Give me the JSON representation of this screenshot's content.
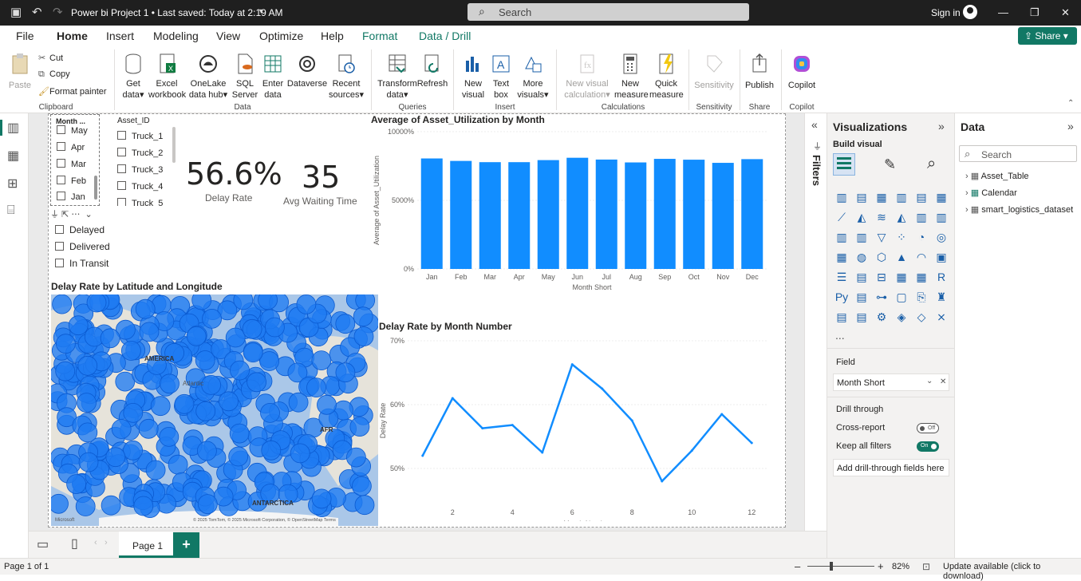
{
  "titlebar": {
    "file_title": "Power bi Project 1  •  Last saved: Today at 2:19 AM",
    "search_placeholder": "Search",
    "sign_in": "Sign in"
  },
  "menu": {
    "tabs": [
      "File",
      "Home",
      "Insert",
      "Modeling",
      "View",
      "Optimize",
      "Help",
      "Format",
      "Data / Drill"
    ],
    "active": "Home",
    "share": "Share"
  },
  "ribbon": {
    "clipboard": {
      "paste": "Paste",
      "cut": "Cut",
      "copy": "Copy",
      "format_painter": "Format painter",
      "label": "Clipboard"
    },
    "data": {
      "get_data": "Get data",
      "excel": "Excel workbook",
      "onelake": "OneLake data hub",
      "sql": "SQL Server",
      "enter": "Enter data",
      "dataverse": "Dataverse",
      "recent": "Recent sources",
      "label": "Data"
    },
    "queries": {
      "transform": "Transform data",
      "refresh": "Refresh",
      "label": "Queries"
    },
    "insert": {
      "new_visual": "New visual",
      "text_box": "Text box",
      "more_visuals": "More visuals",
      "label": "Insert"
    },
    "calculations": {
      "new_visual_calc": "New visual calculation",
      "new_measure": "New measure",
      "quick_measure": "Quick measure",
      "label": "Calculations"
    },
    "sensitivity": {
      "btn": "Sensitivity",
      "label": "Sensitivity"
    },
    "share": {
      "publish": "Publish",
      "label": "Share"
    },
    "copilot": {
      "btn": "Copilot",
      "label": "Copilot"
    }
  },
  "slicers": {
    "month": {
      "header": "Month ...",
      "items": [
        "May",
        "Apr",
        "Mar",
        "Feb",
        "Jan"
      ]
    },
    "asset": {
      "header": "Asset_ID",
      "items": [
        "Truck_1",
        "Truck_2",
        "Truck_3",
        "Truck_4",
        "Truck_5"
      ]
    },
    "status": {
      "items": [
        "Delayed",
        "Delivered",
        "In Transit"
      ]
    }
  },
  "kpis": {
    "delay_rate": {
      "value": "56.6%",
      "label": "Delay Rate"
    },
    "avg_wait": {
      "value": "35",
      "label": "Avg Waiting Time"
    }
  },
  "map": {
    "title": "Delay Rate by Latitude and Longitude",
    "label_america": "AMERICA",
    "label_antarctica": "ANTARCTICA",
    "label_atlantic": "Atlantic",
    "label_afr": "AFR",
    "credits": "© 2025 TomTom, © 2025 Microsoft Corporation, © OpenStreetMap Terms",
    "brand": "Microsoft"
  },
  "chart_data": [
    {
      "type": "bar",
      "title": "Average of Asset_Utilization by Month",
      "xlabel": "Month Short",
      "ylabel": "Average of Asset_Utilization",
      "categories": [
        "Jan",
        "Feb",
        "Mar",
        "Apr",
        "May",
        "Jun",
        "Jul",
        "Aug",
        "Sep",
        "Oct",
        "Nov",
        "Dec"
      ],
      "values": [
        8050,
        7870,
        7780,
        7780,
        7930,
        8100,
        7970,
        7760,
        8020,
        7960,
        7730,
        8000
      ],
      "yticks": [
        "0%",
        "5000%",
        "10000%"
      ],
      "ylim": [
        0,
        10000
      ],
      "color": "#118dff"
    },
    {
      "type": "line",
      "title": "Delay Rate by Month Number",
      "xlabel": "Month Number",
      "ylabel": "Delay Rate",
      "x": [
        1,
        2,
        3,
        4,
        5,
        6,
        7,
        8,
        9,
        10,
        11,
        12
      ],
      "values": [
        52.0,
        61.0,
        56.3,
        56.8,
        52.5,
        66.3,
        62.5,
        57.5,
        48.0,
        52.8,
        58.5,
        54.0
      ],
      "xticks": [
        "2",
        "4",
        "6",
        "8",
        "10",
        "12"
      ],
      "yticks": [
        "50%",
        "60%",
        "70%"
      ],
      "ylim": [
        45,
        70
      ],
      "color": "#118dff"
    }
  ],
  "visualizations": {
    "title": "Visualizations",
    "build": "Build visual",
    "field_label": "Field",
    "field_value": "Month Short",
    "drill_through": "Drill through",
    "cross_report": "Cross-report",
    "cross_report_state": "Off",
    "keep_filters": "Keep all filters",
    "keep_filters_state": "On",
    "add_drill": "Add drill-through fields here",
    "more": "..."
  },
  "filters": {
    "label": "Filters"
  },
  "data_pane": {
    "title": "Data",
    "search_placeholder": "Search",
    "tables": [
      "Asset_Table",
      "Calendar",
      "smart_logistics_dataset"
    ]
  },
  "pages": {
    "tab": "Page 1",
    "add": "+"
  },
  "status": {
    "page_info": "Page 1 of 1",
    "zoom": "82%",
    "update": "Update available (click to download)"
  },
  "colors": {
    "accent": "#117865",
    "series": "#118dff"
  }
}
